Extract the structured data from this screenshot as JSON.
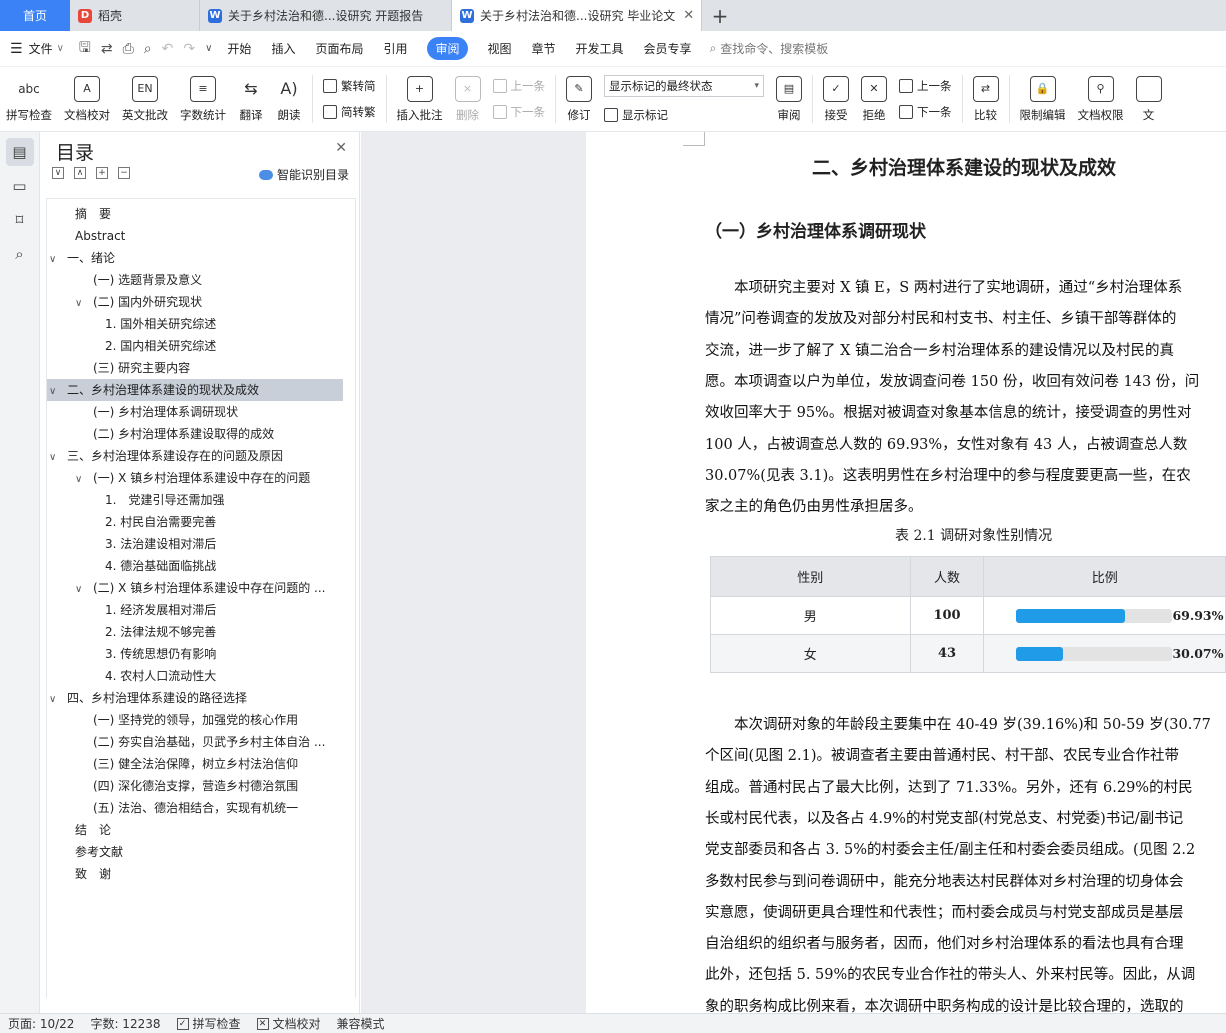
{
  "tabs": {
    "home": "首页",
    "daoke": "稻壳",
    "doc1": "关于乡村法治和德...设研究 开题报告",
    "doc2": "关于乡村法治和德...设研究 毕业论文",
    "add": "+"
  },
  "menu": {
    "file": "文件",
    "items": [
      "开始",
      "插入",
      "页面布局",
      "引用",
      "审阅",
      "视图",
      "章节",
      "开发工具",
      "会员专享"
    ],
    "active": "审阅",
    "search": "查找命令、搜索模板"
  },
  "ribbon": {
    "spell": "拼写检查",
    "proof": "文档校对",
    "en_grade": "英文批改",
    "wordcount": "字数统计",
    "translate": "翻译",
    "read": "朗读",
    "trad": "繁转简",
    "simp": "简转繁",
    "insert_comment": "插入批注",
    "delete": "删除",
    "prev_comment": "上一条",
    "next_comment": "下一条",
    "revise": "修订",
    "markup_state": "显示标记的最终状态",
    "show_markup": "显示标记",
    "review": "审阅",
    "accept": "接受",
    "reject": "拒绝",
    "prev": "上一条",
    "next": "下一条",
    "compare": "比较",
    "restrict": "限制编辑",
    "rights": "文档权限",
    "more": "文"
  },
  "toc": {
    "title": "目录",
    "smart": "智能识别目录",
    "items": [
      {
        "text": "摘　要",
        "level": 0,
        "chev": ""
      },
      {
        "text": "Abstract",
        "level": 0,
        "chev": ""
      },
      {
        "text": "一、绪论",
        "level": 0,
        "chev": "v"
      },
      {
        "text": "(一) 选题背景及意义",
        "level": 1,
        "chev": ""
      },
      {
        "text": "(二) 国内外研究现状",
        "level": 1,
        "chev": "v"
      },
      {
        "text": "1. 国外相关研究综述",
        "level": 2,
        "chev": ""
      },
      {
        "text": "2. 国内相关研究综述",
        "level": 2,
        "chev": ""
      },
      {
        "text": "(三) 研究主要内容",
        "level": 1,
        "chev": ""
      },
      {
        "text": "二、乡村治理体系建设的现状及成效",
        "level": 0,
        "chev": "v"
      },
      {
        "text": "(一) 乡村治理体系调研现状",
        "level": 1,
        "chev": ""
      },
      {
        "text": "(二) 乡村治理体系建设取得的成效",
        "level": 1,
        "chev": ""
      },
      {
        "text": "三、乡村治理体系建设存在的问题及原因",
        "level": 0,
        "chev": "v"
      },
      {
        "text": "(一) X 镇乡村治理体系建设中存在的问题",
        "level": 1,
        "chev": "v"
      },
      {
        "text": "1.　党建引导还需加强",
        "level": 2,
        "chev": ""
      },
      {
        "text": "2. 村民自治需要完善",
        "level": 2,
        "chev": ""
      },
      {
        "text": "3. 法治建设相对滞后",
        "level": 2,
        "chev": ""
      },
      {
        "text": "4. 德治基础面临挑战",
        "level": 2,
        "chev": ""
      },
      {
        "text": "(二) X 镇乡村治理体系建设中存在问题的 ...",
        "level": 1,
        "chev": "v"
      },
      {
        "text": "1. 经济发展相对滞后",
        "level": 2,
        "chev": ""
      },
      {
        "text": "2. 法律法规不够完善",
        "level": 2,
        "chev": ""
      },
      {
        "text": "3. 传统思想仍有影响",
        "level": 2,
        "chev": ""
      },
      {
        "text": "4. 农村人口流动性大",
        "level": 2,
        "chev": ""
      },
      {
        "text": "四、乡村治理体系建设的路径选择",
        "level": 0,
        "chev": "v"
      },
      {
        "text": "(一) 坚持党的领导，加强党的核心作用",
        "level": 1,
        "chev": ""
      },
      {
        "text": "(二) 夯实自治基础，贝武予乡村主体自治 ...",
        "level": 1,
        "chev": ""
      },
      {
        "text": "(三) 健全法治保障，树立乡村法治信仰",
        "level": 1,
        "chev": ""
      },
      {
        "text": "(四) 深化德治支撑，营造乡村德治氛围",
        "level": 1,
        "chev": ""
      },
      {
        "text": "(五) 法治、德治相结合，实现有机统一",
        "level": 1,
        "chev": ""
      },
      {
        "text": "结　论",
        "level": 0,
        "chev": ""
      },
      {
        "text": "参考文献",
        "level": 0,
        "chev": ""
      },
      {
        "text": "致　谢",
        "level": 0,
        "chev": ""
      }
    ],
    "selected_index": 8
  },
  "doc": {
    "h2": "二、乡村治理体系建设的现状及成效",
    "h3": "（一）乡村治理体系调研现状",
    "para1": [
      "　　本项研究主要对 X 镇 E，S 两村进行了实地调研，通过“乡村治理体系",
      "情况”问卷调查的发放及对部分村民和村支书、村主任、乡镇干部等群体的",
      "交流，进一步了解了 X 镇二治合一乡村治理体系的建设情况以及村民的真",
      "愿。本项调查以户为单位，发放调查问卷 150 份，收回有效问卷 143 份，问",
      "效收回率大于 95%。根据对被调查对象基本信息的统计，接受调查的男性对",
      "100 人，占被调查总人数的 69.93%，女性对象有 43 人，占被调查总人数",
      "30.07%(见表 3.1)。这表明男性在乡村治理中的参与程度要更高一些，在农",
      "家之主的角色仍由男性承担居多。"
    ],
    "caption": "表 2.1 调研对象性别情况",
    "table": {
      "headers": [
        "性别",
        "人数",
        "比例"
      ],
      "rows": [
        {
          "gender": "男",
          "count": "100",
          "ratio": "69.93%",
          "fraction": 0.6993
        },
        {
          "gender": "女",
          "count": "43",
          "ratio": "30.07%",
          "fraction": 0.3007
        }
      ]
    },
    "para2": [
      "　　本次调研对象的年龄段主要集中在 40-49 岁(39.16%)和 50-59 岁(30.77",
      "个区间(见图 2.1)。被调查者主要由普通村民、村干部、农民专业合作社带",
      "组成。普通村民占了最大比例，达到了 71.33%。另外，还有 6.29%的村民",
      "长或村民代表，以及各占 4.9%的村党支部(村党总支、村党委)书记/副书记",
      "党支部委员和各占 3. 5%的村委会主任/副主任和村委会委员组成。(见图 2.2",
      "多数村民参与到问卷调研中，能充分地表达村民群体对乡村治理的切身体会",
      "实意愿，使调研更具合理性和代表性；而村委会成员与村党支部成员是基层",
      "自治组织的组织者与服务者，因而，他们对乡村治理体系的看法也具有合理",
      "此外，还包括 5. 59%的农民专业合作社的带头人、外来村民等。因此，从调",
      "象的职务构成比例来看，本次调研中职务构成的设计是比较合理的，选取的"
    ]
  },
  "status": {
    "page": "页面: 10/22",
    "words": "字数: 12238",
    "spell": "拼写检查",
    "proof": "文档校对",
    "compat": "兼容模式"
  }
}
